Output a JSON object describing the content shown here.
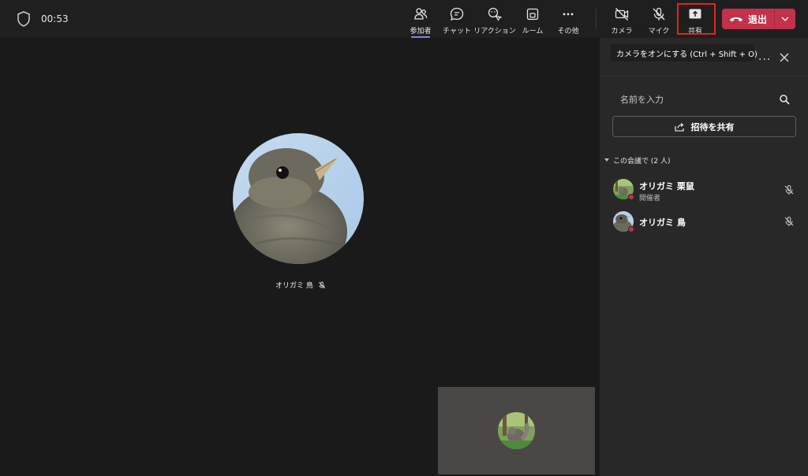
{
  "header": {
    "timer": "00:53",
    "buttons": {
      "participants": "参加者",
      "chat": "チャット",
      "reactions": "リアクション",
      "rooms": "ルーム",
      "more": "その他",
      "camera": "カメラ",
      "mic": "マイク",
      "share": "共有",
      "leave": "退出"
    }
  },
  "stage": {
    "speaker_name": "オリガミ 鳥"
  },
  "tooltip": "カメラをオンにする (Ctrl + Shift + O)",
  "panel": {
    "more": "...",
    "search_placeholder": "名前を入力",
    "invite_label": "招待を共有",
    "section_label": "この会議で (2 人)",
    "participants": [
      {
        "name": "オリガミ 栗鼠",
        "role": "開催者"
      },
      {
        "name": "オリガミ 鳥",
        "role": ""
      }
    ]
  },
  "colors": {
    "leave_button": "#c4314b",
    "active_tab_indicator": "#7f85f5",
    "highlight_box": "#e0261f"
  }
}
